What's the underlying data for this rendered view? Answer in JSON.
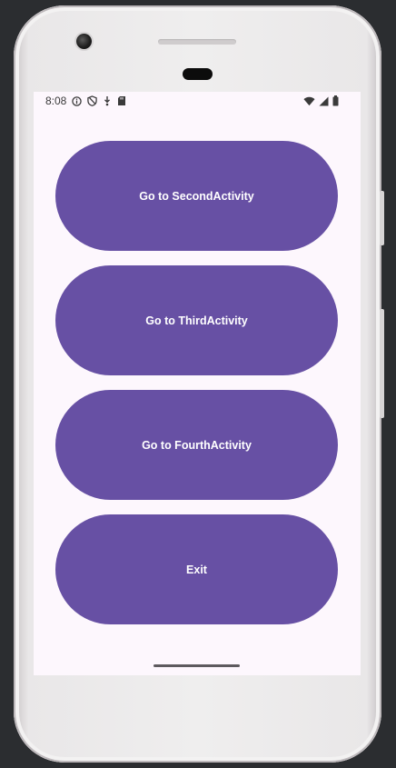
{
  "status_bar": {
    "time": "8:08",
    "icons_left": [
      "info-icon",
      "shield-icon",
      "download-icon",
      "sd-card-icon"
    ],
    "icons_right": [
      "wifi-icon",
      "signal-icon",
      "battery-icon"
    ]
  },
  "buttons": [
    {
      "label": "Go to SecondActivity"
    },
    {
      "label": "Go to ThirdActivity"
    },
    {
      "label": "Go to FourthActivity"
    },
    {
      "label": "Exit"
    }
  ],
  "colors": {
    "button_bg": "#6750a4",
    "button_text": "#ffffff",
    "screen_bg": "#fdf7fd"
  }
}
